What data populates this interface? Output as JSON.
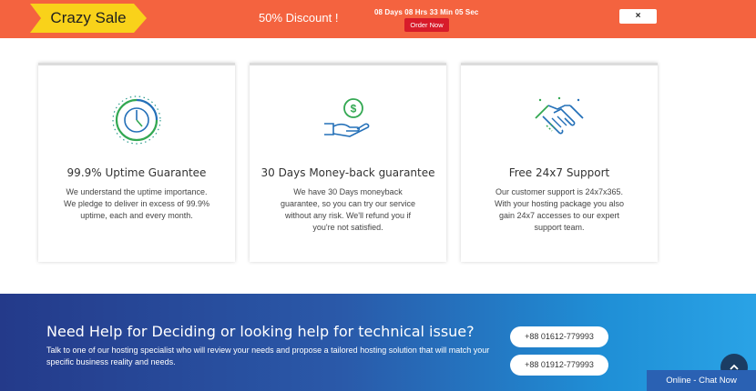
{
  "promo": {
    "badge": "Crazy Sale",
    "discount": "50% Discount !",
    "countdown": "08 Days 08 Hrs 33 Min 05 Sec",
    "order_label": "Order Now",
    "close_label": "×",
    "colors": {
      "bar": "#f4633f",
      "badge": "#f9d21a",
      "order": "#d81b2a"
    }
  },
  "features": [
    {
      "icon": "uptime-gauge-icon",
      "title": "99.9% Uptime Guarantee",
      "desc": "We understand the uptime importance. We pledge to deliver in excess of 99.9% uptime, each and every month."
    },
    {
      "icon": "money-hand-icon",
      "title": "30 Days Money-back guarantee",
      "desc": "We have 30 Days moneyback guarantee, so you can try our service without any risk. We'll refund you if you're not satisfied."
    },
    {
      "icon": "handshake-icon",
      "title": "Free 24x7 Support",
      "desc": "Our customer support is 24x7x365. With your hosting package you also gain 24x7 accesses to our expert support team."
    }
  ],
  "help": {
    "title": "Need Help for Deciding or looking help for technical issue?",
    "desc": "Talk to one of our hosting specialist who will review your needs and propose a tailored hosting solution that will match your specific business reality and needs.",
    "phones": [
      "+88 01612-779993",
      "+88 01912-779993"
    ]
  },
  "scroll_top_icon": "chevron-up-icon",
  "chat_label": "Online - Chat Now"
}
